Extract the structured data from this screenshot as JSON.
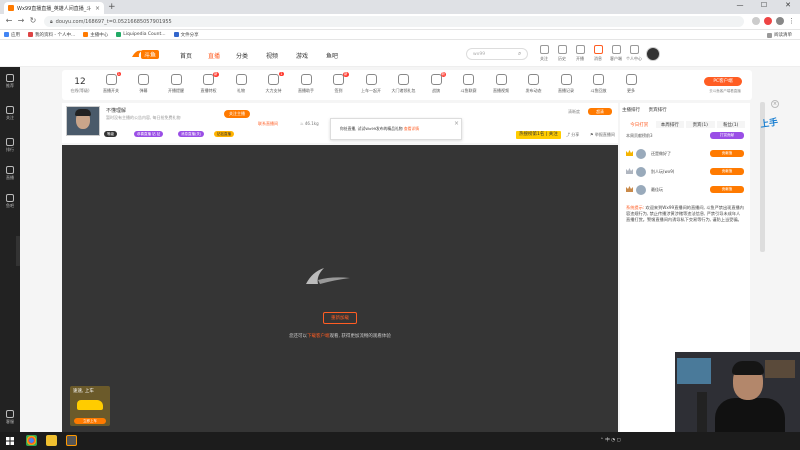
{
  "browser": {
    "tab_title": "Wx99直播直播_英雄人间直播_斗",
    "tab_close": "×",
    "new_tab": "+",
    "url": "douyu.com/168697_t=0.05216685057901955",
    "window_controls": [
      "—",
      "☐",
      "✕"
    ],
    "bookmarks": [
      "应用",
      "我的资料 - 个人中...",
      "主播中心",
      "Liquipedia Count...",
      "文件分享"
    ],
    "bookmarks_other": "阅读清单"
  },
  "site": {
    "logo": "斗鱼",
    "nav": [
      "首页",
      "直播",
      "分类",
      "视频",
      "游戏",
      "鱼吧"
    ],
    "nav_active": 1,
    "search_placeholder": "wx99",
    "header_icons": [
      "关注",
      "历史",
      "开播",
      "消息",
      "客户端",
      "个人中心"
    ]
  },
  "sidebar": {
    "items": [
      "推荐",
      "关注",
      "排行",
      "直播",
      "鱼吧"
    ],
    "bottom": "客服"
  },
  "toolbar": {
    "online_count": "12",
    "online_label": "在线(等级)",
    "tools": [
      {
        "label": "直播开关",
        "badge": "1"
      },
      {
        "label": "弹幕"
      },
      {
        "label": "开播提醒"
      },
      {
        "label": "直播特权",
        "badge": "新"
      },
      {
        "label": "礼物"
      },
      {
        "label": "大力支持",
        "badge": "1"
      },
      {
        "label": "直播助手"
      },
      {
        "label": "签到",
        "badge": "新"
      },
      {
        "label": "上车一起开"
      },
      {
        "label": "大门诸领礼包"
      },
      {
        "label": "战旗",
        "badge": "新"
      },
      {
        "label": "斗鱼联赛"
      },
      {
        "label": "直播视频"
      },
      {
        "label": "发布动态"
      },
      {
        "label": "直播记录"
      },
      {
        "label": "斗鱼回放"
      },
      {
        "label": "更多"
      }
    ],
    "pc_button": "PC客户端",
    "pc_sub": "去斗鱼客户端看直播"
  },
  "streamer": {
    "name": "不懂理解",
    "description": "暂时没有主播的公告内容, 每日抢免费礼物",
    "tags": [
      "等级",
      "恭喜直播 钻 钻",
      "消息直播(关)",
      "钻钻直播"
    ],
    "follow_label": "关注主播",
    "room_link": "联系直播间",
    "weight": "♨ 46.1kg",
    "notice_text": "你处直播, 试试Wx99发布的精品礼物",
    "notice_link": "查看详情",
    "notice_close": "×",
    "hot_list": "热搜榜第1名 | 关注",
    "share": "分享",
    "report": "举报直播间",
    "quality_label": "清晰度",
    "quality_button": "超清"
  },
  "video": {
    "retry": "重新加载",
    "message_prefix": "您还可以",
    "message_link": "下载客户端",
    "message_suffix": "观看, 获得更加流畅的观看体验",
    "promo_title": "速速, 上车",
    "promo_button": "立即上车"
  },
  "right_panel": {
    "tabs_top": [
      "主播排行",
      "贵宾排行"
    ],
    "tabs": [
      "今日打赏",
      "本周排行",
      "贵宾(1)",
      "粉丝(1)"
    ],
    "rank_label": "本周贡献榜前3",
    "rank_button": "打赏贡献",
    "rows": [
      {
        "name": "还是做好了",
        "badge": "贡献值"
      },
      {
        "name": "别人玩(wx9)",
        "badge": "贡献值"
      },
      {
        "name": "最佳玩",
        "badge": "贡献值"
      }
    ],
    "sys_notice_label": "系统提示:",
    "sys_notice_text": "欢迎来到Wx99直播间的直播间, 斗鱼严禁出现直播内容违规行为, 禁止传播涉黄涉赌等违法信息, 严禁引导未成年人直播打赏。警惕直播间内诱导私下交易等行为, 谨防上当受骗。"
  },
  "sticker_text": "上手",
  "taskbar": {
    "tray": "⌃  中  ◔  ▢"
  },
  "colors": {
    "brand": "#ff5d23",
    "accent_orange": "#ff7a00",
    "video_bg": "#353535"
  }
}
